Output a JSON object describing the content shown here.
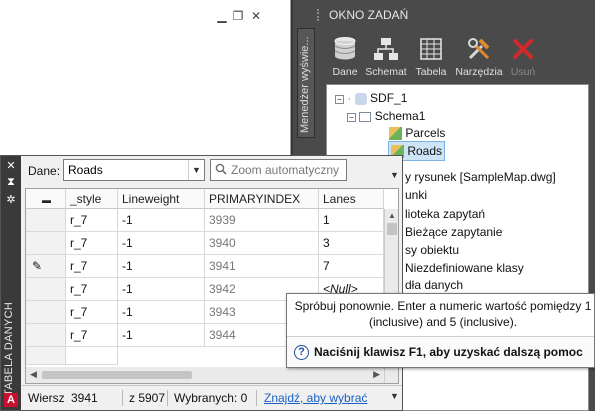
{
  "drawing_window": {
    "buttons": [
      "minimize",
      "restore",
      "close"
    ]
  },
  "task_pane": {
    "title": "OKNO ZADAŃ",
    "side_tab": "Menedżer wyświe...",
    "toolbar": [
      {
        "label": "Dane",
        "icon": "database-icon",
        "enabled": true
      },
      {
        "label": "Schemat",
        "icon": "schema-icon",
        "enabled": true
      },
      {
        "label": "Tabela",
        "icon": "table-icon",
        "enabled": true
      },
      {
        "label": "Narzędzia",
        "icon": "tools-icon",
        "enabled": true
      },
      {
        "label": "Usuń",
        "icon": "delete-icon",
        "enabled": false
      }
    ],
    "tree": [
      {
        "label": "SDF_1",
        "level": 0
      },
      {
        "label": "Schema1",
        "level": 1
      },
      {
        "label": "Parcels",
        "level": 2
      },
      {
        "label": "Roads",
        "level": 2,
        "selected": true
      },
      {
        "label": "y rysunek [SampleMap.dwg]",
        "level": 0
      },
      {
        "label": "unki",
        "level": 0
      },
      {
        "label": "lioteka zapytań",
        "level": 0
      },
      {
        "label": "Bieżące zapytanie",
        "level": 0
      },
      {
        "label": "sy obiektu",
        "level": 0
      },
      {
        "label": "Niezdefiniowane klasy",
        "level": 0
      },
      {
        "label": "dła danych",
        "level": 0
      }
    ]
  },
  "data_table": {
    "side_title": "TABELA DANYCH",
    "data_label": "Dane:",
    "data_source": "Roads",
    "zoom_placeholder": "Zoom automatyczny",
    "columns": [
      "",
      "_style",
      "Lineweight",
      "PRIMARYINDEX",
      "Lanes"
    ],
    "rows": [
      {
        "marker": "",
        "style": "r_7",
        "lineweight": "-1",
        "index": "3939",
        "lanes": "1"
      },
      {
        "marker": "",
        "style": "r_7",
        "lineweight": "-1",
        "index": "3940",
        "lanes": "3"
      },
      {
        "marker": "✎",
        "style": "r_7",
        "lineweight": "-1",
        "index": "3941",
        "lanes": "7"
      },
      {
        "marker": "",
        "style": "r_7",
        "lineweight": "-1",
        "index": "3942",
        "lanes": "<Null>"
      },
      {
        "marker": "",
        "style": "r_7",
        "lineweight": "-1",
        "index": "3943",
        "lanes": ""
      },
      {
        "marker": "",
        "style": "r_7",
        "lineweight": "-1",
        "index": "3944",
        "lanes": ""
      }
    ],
    "status": {
      "row_label": "Wiersz",
      "row_value": "3941",
      "of_label": "z 5907",
      "selected_label": "Wybranych: 0",
      "find_link": "Znajdź, aby wybrać"
    }
  },
  "tooltip": {
    "message": "Spróbuj ponownie. Enter a numeric wartość pomiędzy 1 (inclusive) and 5 (inclusive).",
    "help": "Naciśnij klawisz F1, aby uzyskać dalszą pomoc"
  },
  "colors": {
    "accent_red": "#c8102e",
    "selection": "#cde4f7",
    "link": "#1a5fc4"
  }
}
